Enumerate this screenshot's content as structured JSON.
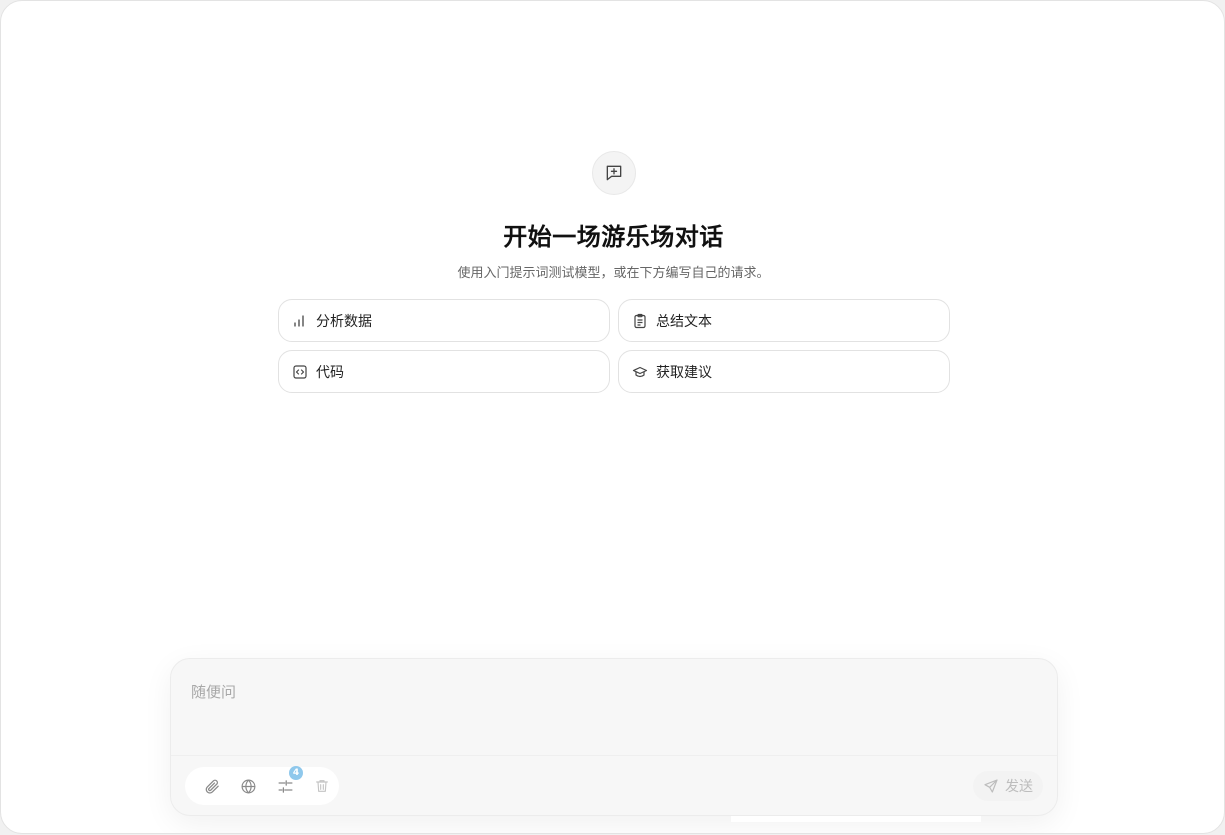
{
  "hero": {
    "icon": "message-plus-icon",
    "title": "开始一场游乐场对话",
    "subtitle": "使用入门提示词测试模型，或在下方编写自己的请求。"
  },
  "prompts": [
    {
      "label": "分析数据",
      "icon": "bar-chart-icon"
    },
    {
      "label": "总结文本",
      "icon": "clipboard-icon"
    },
    {
      "label": "代码",
      "icon": "code-icon"
    },
    {
      "label": "获取建议",
      "icon": "graduation-cap-icon"
    }
  ],
  "composer": {
    "placeholder": "随便问",
    "tools": [
      {
        "name": "attach",
        "icon": "paperclip-icon"
      },
      {
        "name": "web",
        "icon": "globe-icon"
      },
      {
        "name": "settings",
        "icon": "sliders-icon",
        "badge": "4"
      },
      {
        "name": "clear",
        "icon": "trash-icon"
      }
    ],
    "send_label": "发送",
    "send_icon": "send-icon"
  },
  "colors": {
    "badge": "#8fc8ec",
    "placeholder": "#a8a8a8",
    "send_text": "#bdbdbd"
  }
}
